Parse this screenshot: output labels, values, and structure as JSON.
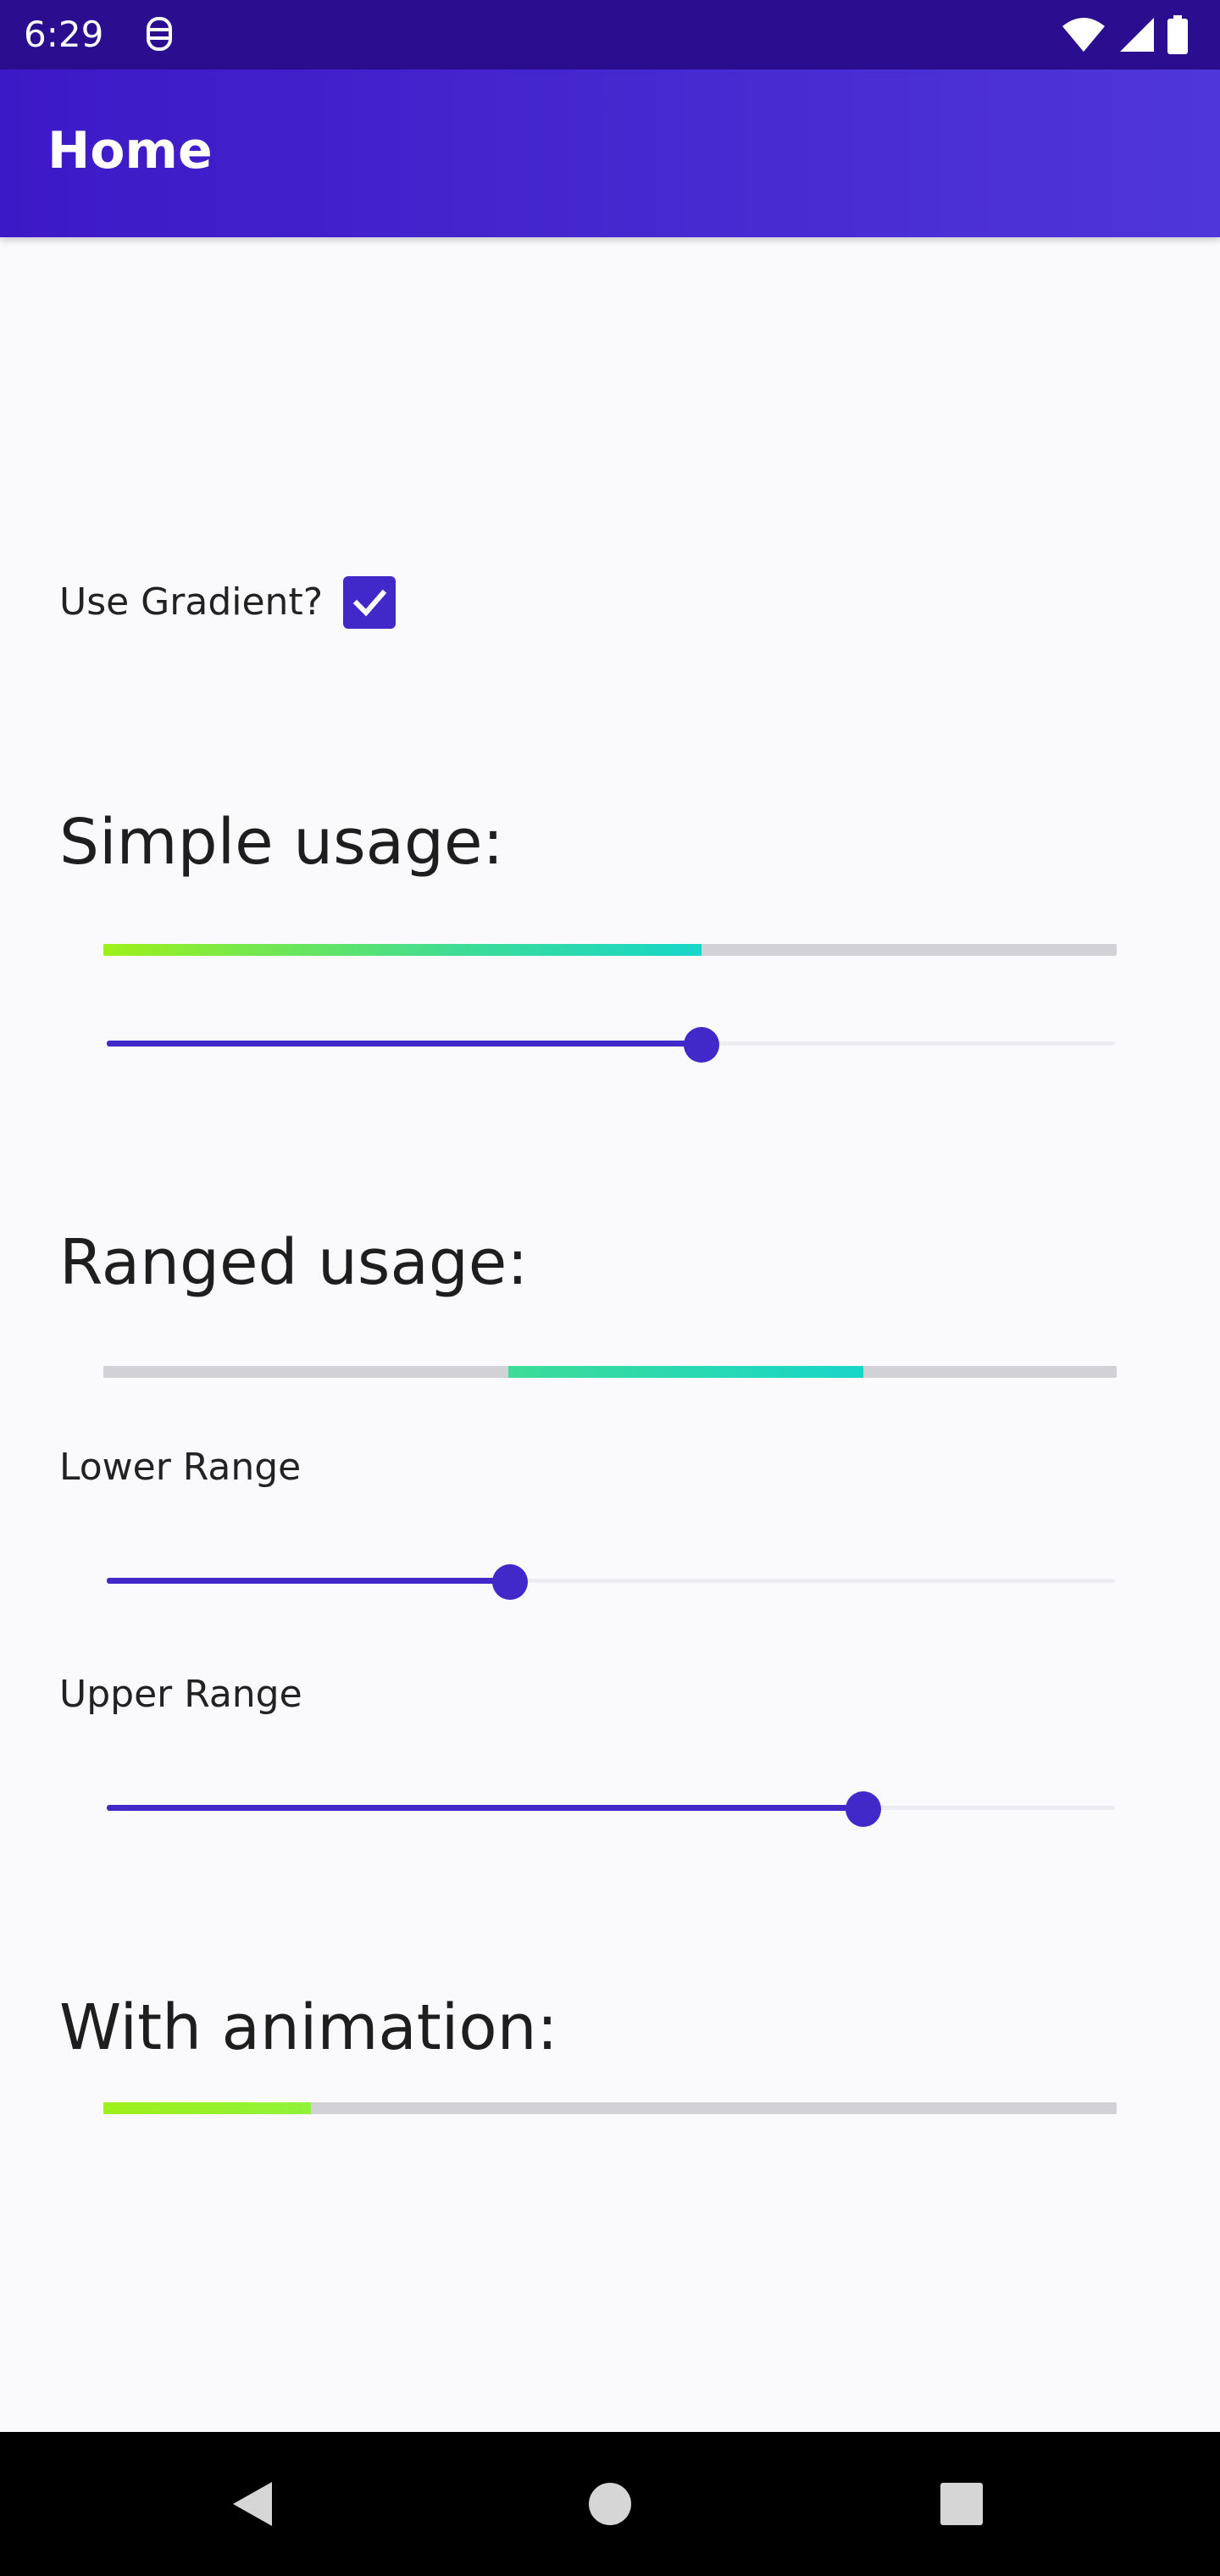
{
  "status_bar": {
    "time": "6:29",
    "icons": [
      "app-notification-icon",
      "wifi-icon",
      "signal-icon",
      "battery-icon"
    ]
  },
  "app_bar": {
    "title": "Home"
  },
  "gradient_option": {
    "label": "Use Gradient?",
    "checked": true
  },
  "simple": {
    "title": "Simple usage:",
    "progress": 0.59,
    "slider_value": 0.59
  },
  "ranged": {
    "title": "Ranged usage:",
    "lower": 0.4,
    "upper": 0.75,
    "lower_label": "Lower Range",
    "upper_label": "Upper Range"
  },
  "animation": {
    "title": "With animation:",
    "progress": 0.205
  },
  "colors": {
    "accent": "#4128c9",
    "status_bar": "#2a0e8f",
    "gradient_start": "#9ef01a",
    "gradient_mid": "#3ddc97",
    "gradient_end": "#17d6c9",
    "track": "#d2d2d6"
  },
  "nav_bar": {
    "icons": [
      "back-icon",
      "home-icon",
      "recents-icon"
    ]
  }
}
